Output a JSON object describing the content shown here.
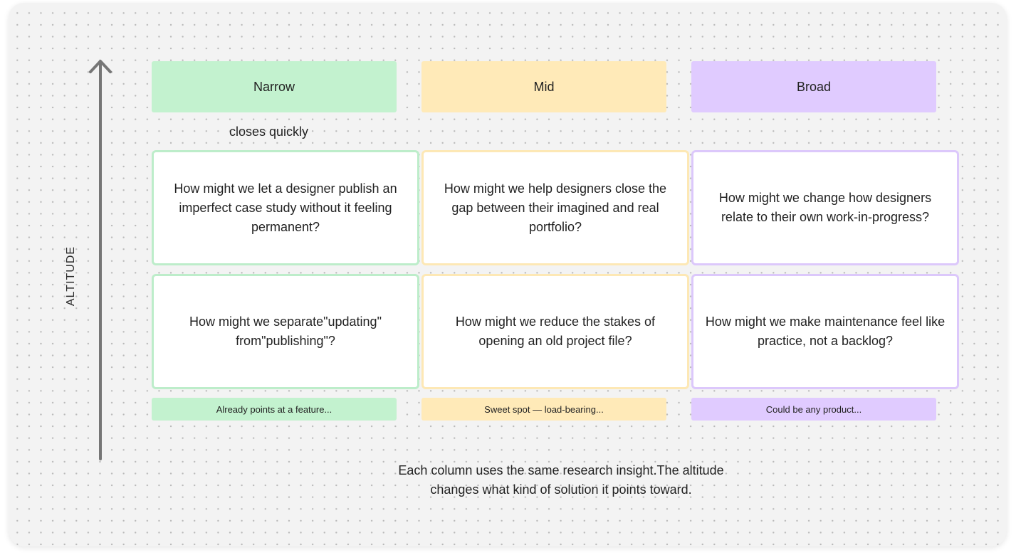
{
  "axis": {
    "label": "ALTITUDE"
  },
  "note": "closes quickly",
  "columns": [
    {
      "header": "Narrow",
      "color_fill": "#c3f2cf",
      "color_border": "#bdedca",
      "cards": [
        "How might we let a designer publish an imperfect case study without it feeling permanent?",
        "How might we separate\"updating\" from\"publishing\"?"
      ],
      "footer": "Already points at a feature..."
    },
    {
      "header": "Mid",
      "color_fill": "#ffeab8",
      "color_border": "#fde8b5",
      "cards": [
        "How might we help designers close the gap between their imagined and real portfolio?",
        "How might we reduce the stakes of opening an old project file?"
      ],
      "footer": "Sweet spot — load-bearing..."
    },
    {
      "header": "Broad",
      "color_fill": "#e0cbff",
      "color_border": "#dcc8fb",
      "cards": [
        "How might we change how designers relate to their own work-in-progress?",
        "How might we make maintenance feel like practice, not a backlog?"
      ],
      "footer": "Could be any product..."
    }
  ],
  "caption": "Each column uses the same research insight.The altitude changes what kind of solution it points toward."
}
